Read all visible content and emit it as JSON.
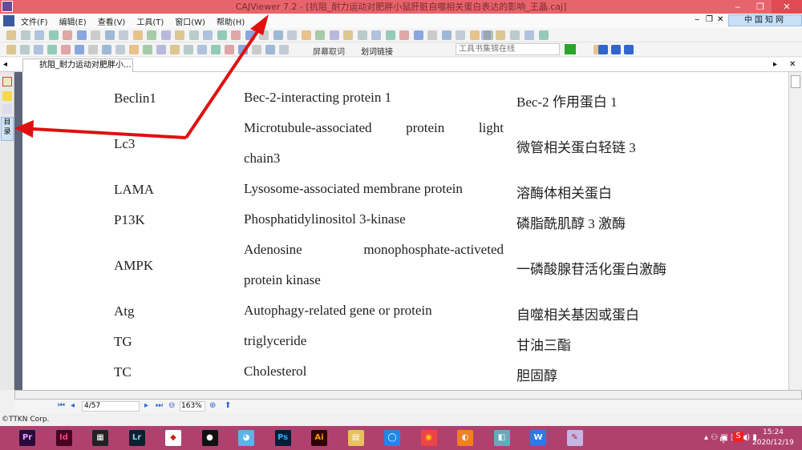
{
  "window": {
    "title": "CAJViewer 7.2 - [抗阻_耐力运动对肥胖小鼠肝脏自噬相关蛋白表达的影响_王晶.caj]",
    "minimize": "‒",
    "restore": "❐",
    "close": "✕"
  },
  "menu": {
    "items": [
      "文件(F)",
      "编辑(E)",
      "查看(V)",
      "工具(T)",
      "窗口(W)",
      "帮助(H)"
    ],
    "mdi_min": "‒",
    "mdi_restore": "❐",
    "mdi_close": "✕"
  },
  "brand": {
    "label": "中国知网"
  },
  "toolbar": {
    "screen_word": "屏幕取词",
    "word_link": "划词链接",
    "search_placeholder": "工具书集锦在线"
  },
  "tab": {
    "label": "抗阻_耐力运动对肥胖小..."
  },
  "sidebar": {
    "catalog_label": "目录"
  },
  "table": {
    "rows": [
      {
        "abbr": "Beclin1",
        "full": [
          "Bec-2-interacting protein 1"
        ],
        "cn": "Bec-2 作用蛋白 1"
      },
      {
        "abbr": "Lc3",
        "full": [
          "Microtubule-associated protein light",
          "chain3"
        ],
        "cn": "微管相关蛋白轻链 3"
      },
      {
        "abbr": "LAMA",
        "full": [
          "Lysosome-associated membrane protein"
        ],
        "cn": "溶酶体相关蛋白"
      },
      {
        "abbr": "P13K",
        "full": [
          "Phosphatidylinositol 3-kinase"
        ],
        "cn": "磷脂酰肌醇 3 激酶"
      },
      {
        "abbr": "AMPK",
        "full": [
          "Adenosine monophosphate-activeted",
          "protein kinase"
        ],
        "cn": "一磷酸腺苷活化蛋白激酶"
      },
      {
        "abbr": "Atg",
        "full": [
          "Autophagy-related gene or protein"
        ],
        "cn": "自噬相关基因或蛋白"
      },
      {
        "abbr": "TG",
        "full": [
          "triglyceride"
        ],
        "cn": "甘油三酯"
      },
      {
        "abbr": "TC",
        "full": [
          "Cholesterol"
        ],
        "cn": "胆固醇"
      }
    ]
  },
  "status": {
    "page": "4/57",
    "zoom": "163%"
  },
  "footer": {
    "copyright": "©TTKN Corp."
  },
  "taskbar": {
    "apps": [
      {
        "label": "Pr",
        "color": "#2a0a3a",
        "fg": "#e7a0ff"
      },
      {
        "label": "Id",
        "color": "#49021f",
        "fg": "#ff3d8b"
      },
      {
        "label": "▦",
        "color": "#222",
        "fg": "#fff"
      },
      {
        "label": "Lr",
        "color": "#0e1f2e",
        "fg": "#8fc6f0"
      },
      {
        "label": "◆",
        "color": "#fff",
        "fg": "#c22"
      },
      {
        "label": "●",
        "color": "#111",
        "fg": "#fff"
      },
      {
        "label": "◕",
        "color": "#59b4e8",
        "fg": "#fff"
      },
      {
        "label": "Ps",
        "color": "#001e36",
        "fg": "#31a8ff"
      },
      {
        "label": "Ai",
        "color": "#330000",
        "fg": "#ff9a00"
      },
      {
        "label": "▤",
        "color": "#e8c060",
        "fg": "#fff"
      },
      {
        "label": "◯",
        "color": "#1e88e5",
        "fg": "#fff"
      },
      {
        "label": "◉",
        "color": "#e44",
        "fg": "#fc0"
      },
      {
        "label": "◐",
        "color": "#f08020",
        "fg": "#fff"
      },
      {
        "label": "◧",
        "color": "#6ab",
        "fg": "#fff"
      },
      {
        "label": "W",
        "color": "#2a7be4",
        "fg": "#fff"
      },
      {
        "label": "✎",
        "color": "#c6b6e6",
        "fg": "#a22"
      }
    ],
    "ime": "中",
    "time": "15:24",
    "date": "2020/12/19"
  },
  "colors": {
    "titlebar": "#e8646c",
    "taskbar": "#b0416f",
    "annotation_arrow": "#e01010"
  }
}
